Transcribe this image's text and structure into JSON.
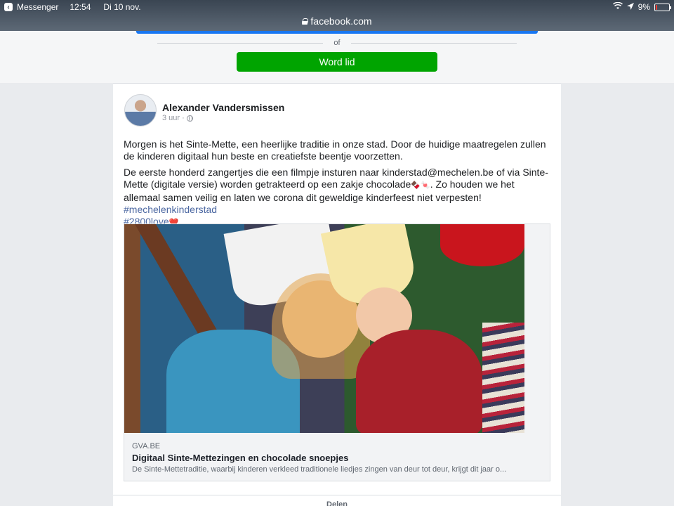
{
  "status_bar": {
    "back_app": "Messenger",
    "time": "12:54",
    "date": "Di 10 nov.",
    "battery": "9%",
    "battery_level": 0.09
  },
  "url_bar": {
    "domain": "facebook.com"
  },
  "login": {
    "or_text": "of",
    "join_label": "Word lid"
  },
  "post": {
    "author": "Alexander Vandersmissen",
    "time": "3 uur",
    "separator": "·",
    "paragraph1": "Morgen is het Sinte-Mette, een heerlijke traditie in onze stad. Door de huidige maatregelen zullen de kinderen digitaal hun beste en creatiefste beentje voorzetten.",
    "paragraph2_a": "De eerste honderd zangertjes die een filmpje insturen naar kinderstad@mechelen.be of via Sinte-Mette (digitale versie) worden getrakteerd op een zakje chocolade",
    "paragraph2_emoji": "🍫🍬",
    "paragraph2_b": ". Zo houden we het allemaal samen veilig en laten we corona dit geweldige kinderfeest niet verpesten! ",
    "hashtag1": "#mechelenkinderstad",
    "hashtag2": "#2800love",
    "heart": "❤️"
  },
  "link_preview": {
    "domain": "GVA.BE",
    "title": "Digitaal Sinte-Mettezingen en chocolade snoepjes",
    "description": "De Sinte-Mettetraditie, waarbij kinderen verkleed traditionele liedjes zingen van deur tot deur, krijgt dit jaar o..."
  },
  "actions": {
    "share_label": "Delen"
  },
  "colors": {
    "join_button": "#00a400",
    "hashtag": "#4b67a1",
    "accent_blue": "#1877f2"
  }
}
